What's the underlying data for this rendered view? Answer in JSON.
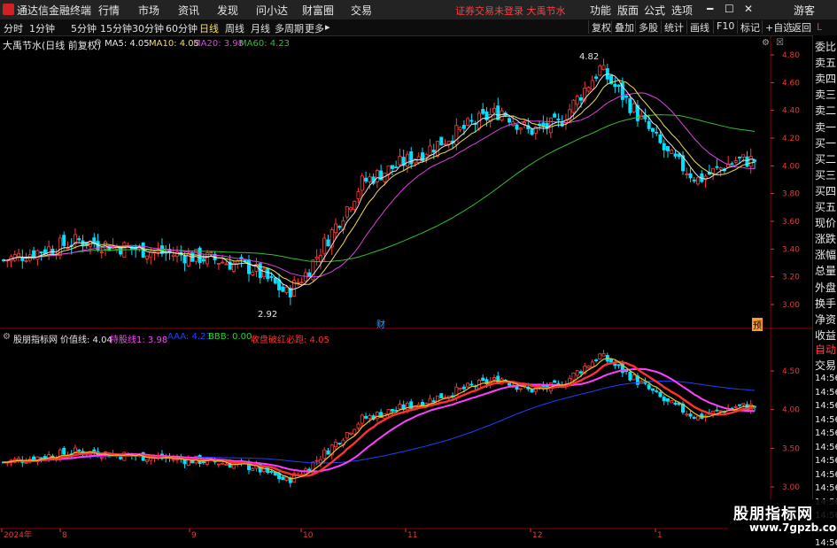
{
  "menubar": {
    "app_title": "通达信金融终端",
    "items": [
      "行情",
      "市场",
      "资讯",
      "发现",
      "问小达",
      "财富圈",
      "交易"
    ],
    "status": "证券交易未登录  大禹节水",
    "right_items": [
      "功能",
      "版面",
      "公式",
      "选项"
    ],
    "guest": "游客",
    "window_buttons": [
      "━",
      "☐",
      "✕"
    ]
  },
  "toolbar": {
    "periods": [
      "分时",
      "1分钟",
      "5分钟",
      "15分钟",
      "30分钟",
      "60分钟",
      "日线",
      "周线",
      "月线",
      "多周期",
      "更多"
    ],
    "active_period": "日线",
    "right_buttons": [
      "复权",
      "叠加",
      "多股",
      "统计",
      "画线",
      "F10",
      "标记",
      "+自选",
      "返回"
    ]
  },
  "main_chart": {
    "stock_label": "大禹节水(日线 前复权)",
    "ma": [
      {
        "label": "MA5: 4.05",
        "color": "#e6e6e6"
      },
      {
        "label": "MA10: 4.05",
        "color": "#f0e050"
      },
      {
        "label": "MA20: 3.98",
        "color": "#e040e0"
      },
      {
        "label": "MA60: 4.23",
        "color": "#30c030"
      }
    ],
    "high_note": "4.82",
    "low_note": "2.92",
    "marker_cai": "财",
    "marker_yu": "预",
    "y_ticks": [
      "4.80",
      "4.60",
      "4.40",
      "4.20",
      "4.00",
      "3.80",
      "3.60",
      "3.40",
      "3.20",
      "3.00"
    ]
  },
  "sub_chart": {
    "title": "股朋指标网",
    "legend": [
      {
        "label": "价值线: 4.04",
        "color": "#e6e6e6"
      },
      {
        "label": "持股线1: 3.98",
        "color": "#ff40ff"
      },
      {
        "label": "AAA: 4.23",
        "color": "#2040ff"
      },
      {
        "label": "BBB: 0.00",
        "color": "#30d030"
      },
      {
        "label": "收盘破红必跑: 4.05",
        "color": "#ff3030"
      }
    ],
    "y_ticks": [
      "4.50",
      "4.00",
      "3.50",
      "3.00"
    ]
  },
  "x_axis": [
    "2024年",
    "8",
    "9",
    "10",
    "11",
    "12",
    "1"
  ],
  "side_panel": {
    "labels": [
      "委比",
      "卖五",
      "卖四",
      "卖三",
      "卖二",
      "卖一",
      "买一",
      "买二",
      "买三",
      "买四",
      "买五",
      "现价",
      "涨跌",
      "涨幅",
      "总量",
      "外盘",
      "换手",
      "净资",
      "收益"
    ],
    "bottom_tab_1": "自动",
    "bottom_tab_2": "交易",
    "times": [
      "14:56",
      "14:56",
      "14:56",
      "14:56",
      "14:56",
      "14:56",
      "14:56",
      "14:56",
      "14:56",
      "14:56",
      "14:56",
      "14:56",
      "14:56"
    ]
  },
  "watermark": {
    "line1": "股朋指标网",
    "line2": "www.7gpzb.com"
  },
  "colors": {
    "up": "#ff3b3b",
    "down": "#00e0ff",
    "ma60": "#30c030",
    "accent": "#e03c3c"
  }
}
